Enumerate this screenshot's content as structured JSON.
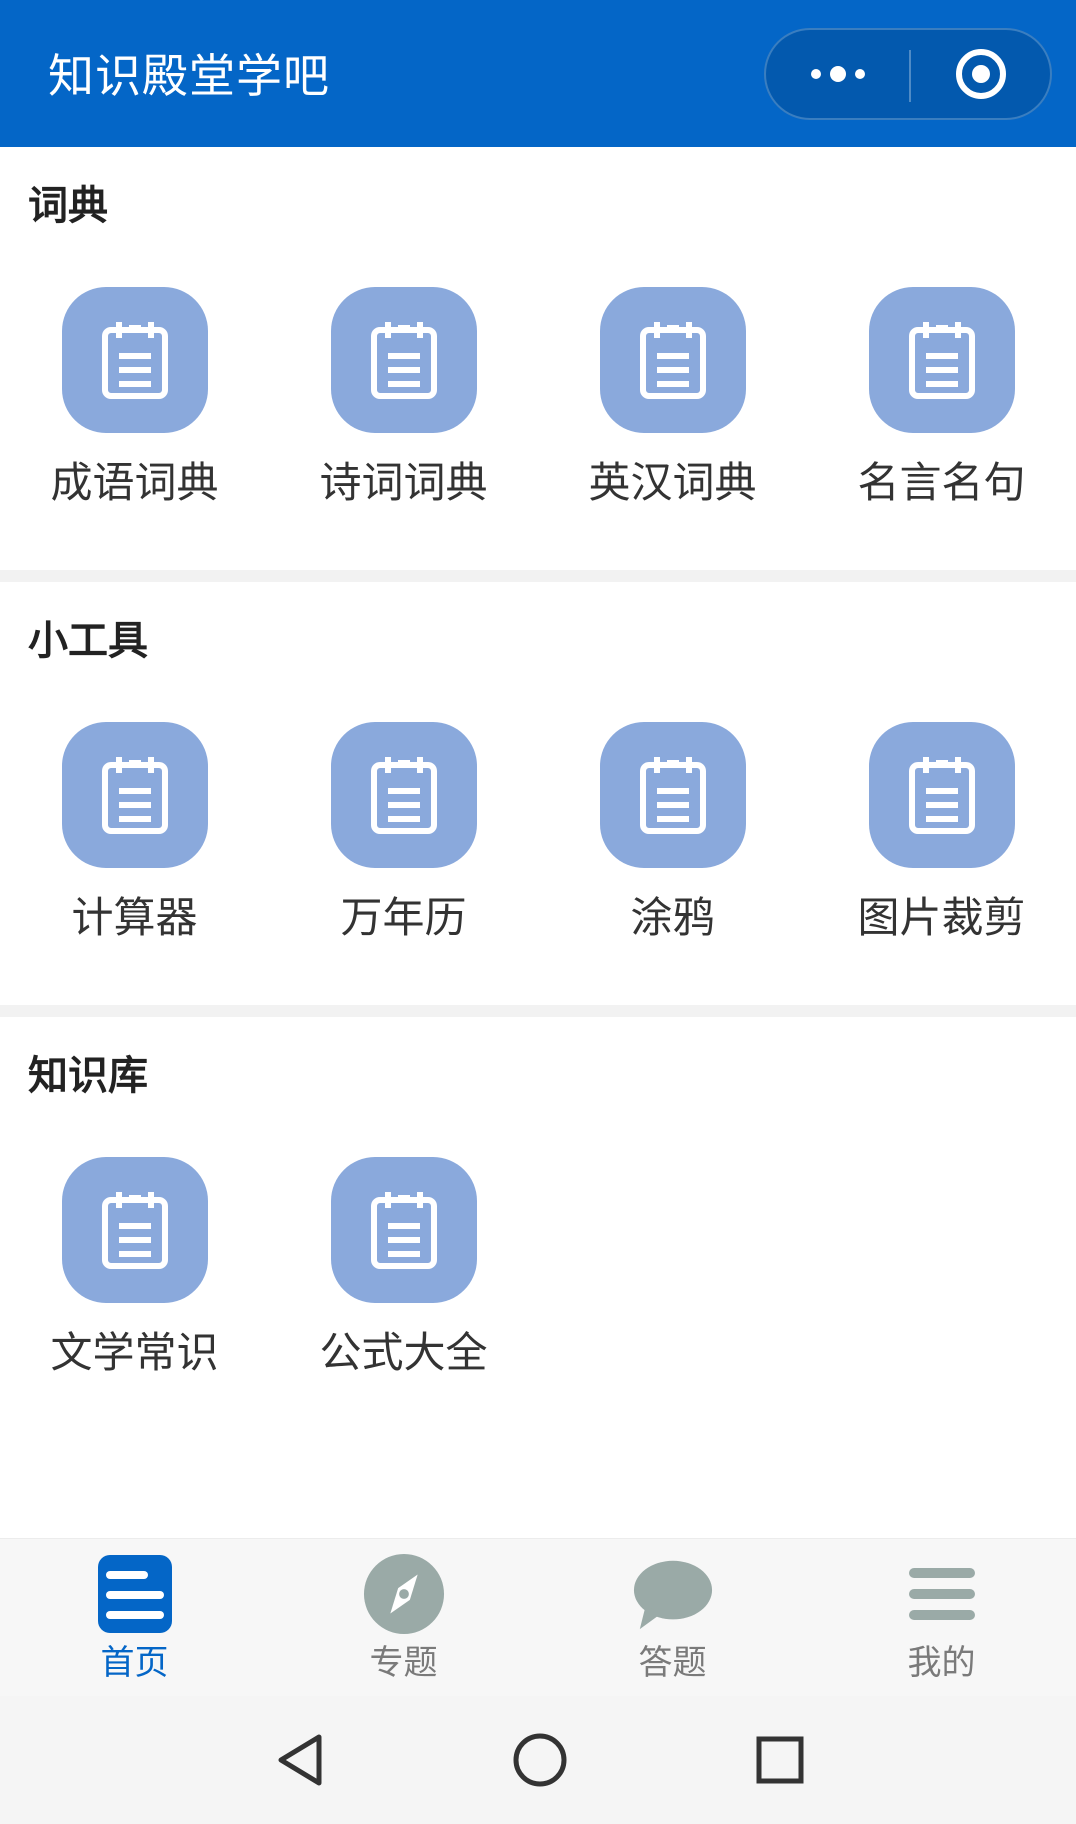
{
  "header": {
    "title": "知识殿堂学吧",
    "more_icon": "more-dots-icon",
    "close_icon": "target-close-icon"
  },
  "colors": {
    "brand": "#0466c7",
    "tile": "#8aa9dc",
    "tab_active": "#0466c7",
    "tab_inactive": "#9aaaa7"
  },
  "sections": [
    {
      "title": "词典",
      "items": [
        {
          "label": "成语词典",
          "icon": "notepad-icon"
        },
        {
          "label": "诗词词典",
          "icon": "notepad-icon"
        },
        {
          "label": "英汉词典",
          "icon": "notepad-icon"
        },
        {
          "label": "名言名句",
          "icon": "notepad-icon"
        }
      ]
    },
    {
      "title": "小工具",
      "items": [
        {
          "label": "计算器",
          "icon": "notepad-icon"
        },
        {
          "label": "万年历",
          "icon": "notepad-icon"
        },
        {
          "label": "涂鸦",
          "icon": "notepad-icon"
        },
        {
          "label": "图片裁剪",
          "icon": "notepad-icon"
        }
      ]
    },
    {
      "title": "知识库",
      "items": [
        {
          "label": "文学常识",
          "icon": "notepad-icon"
        },
        {
          "label": "公式大全",
          "icon": "notepad-icon"
        }
      ]
    }
  ],
  "tabbar": {
    "active": "首页",
    "tabs": [
      {
        "label": "首页",
        "icon": "home-list-icon"
      },
      {
        "label": "专题",
        "icon": "compass-icon"
      },
      {
        "label": "答题",
        "icon": "chat-bubble-icon"
      },
      {
        "label": "我的",
        "icon": "menu-icon"
      }
    ]
  },
  "system_nav": {
    "back_icon": "back-triangle-icon",
    "home_icon": "home-circle-icon",
    "recents_icon": "recents-square-icon"
  }
}
